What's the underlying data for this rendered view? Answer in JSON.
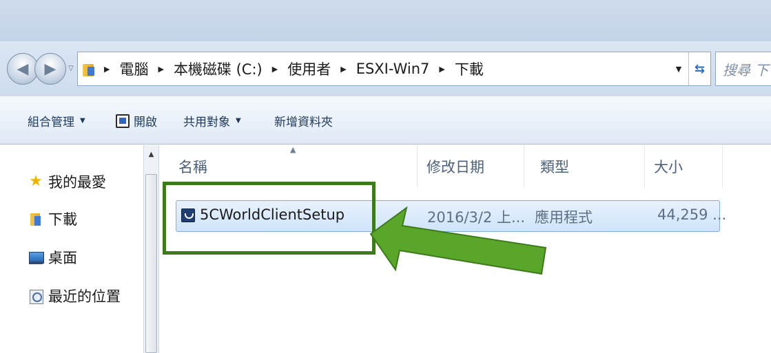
{
  "address": {
    "crumbs": [
      "電腦",
      "本機磁碟 (C:)",
      "使用者",
      "ESXI-Win7",
      "下載"
    ],
    "search_placeholder": "搜尋 下"
  },
  "toolbar": {
    "organize": "組合管理",
    "open": "開啟",
    "share": "共用對象",
    "new_folder": "新增資料夾"
  },
  "nav": {
    "favorites": "我的最愛",
    "items": [
      "下載",
      "桌面",
      "最近的位置"
    ]
  },
  "columns": {
    "name": "名稱",
    "date": "修改日期",
    "type": "類型",
    "size": "大小"
  },
  "file": {
    "name": "5CWorldClientSetup",
    "date": "2016/3/2 上...",
    "type": "應用程式",
    "size": "44,259 ..."
  },
  "colors": {
    "highlight_border": "#3d7a1a",
    "arrow": "#5aa62a"
  }
}
